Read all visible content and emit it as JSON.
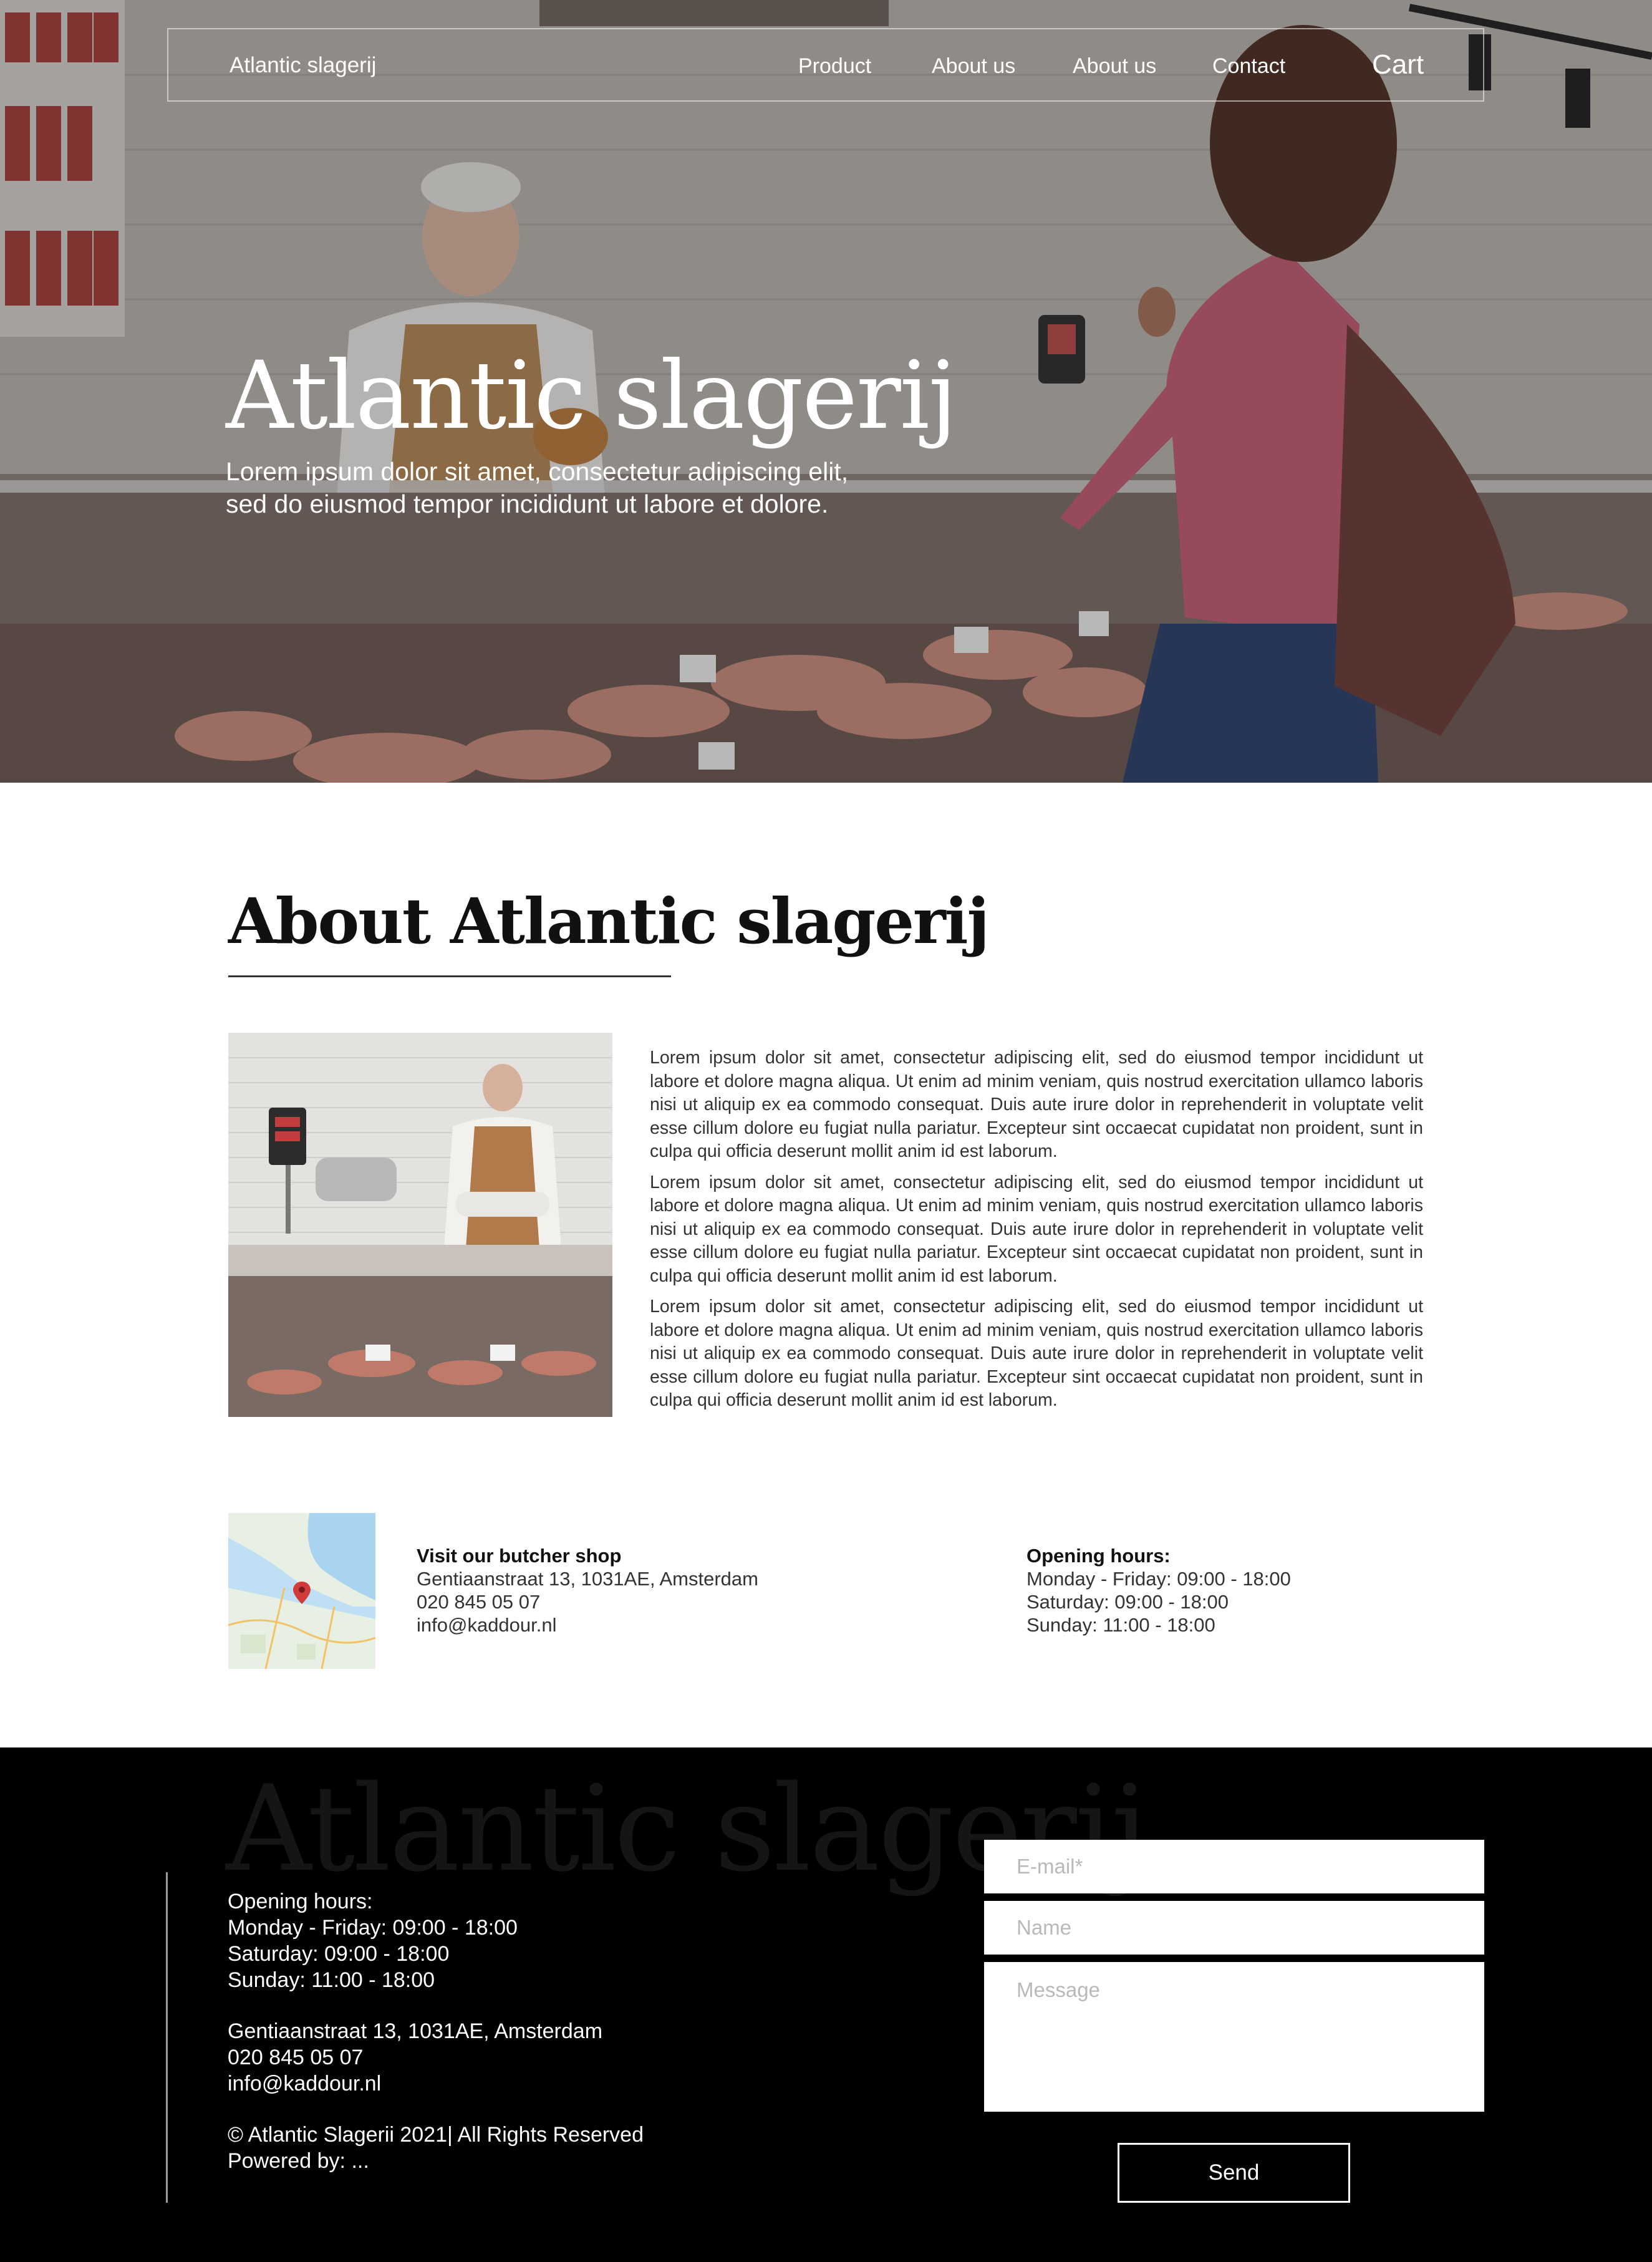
{
  "nav": {
    "brand": "Atlantic slagerij",
    "items": [
      "Product",
      "About us",
      "About us",
      "Contact"
    ],
    "cart": "Cart"
  },
  "hero": {
    "title": "Atlantic slagerij",
    "subtitle_line1": "Lorem ipsum dolor sit amet, consectetur adipiscing elit,",
    "subtitle_line2": "sed do eiusmod tempor incididunt ut labore et dolore."
  },
  "about": {
    "title": "About Atlantic slagerij",
    "paragraphs": [
      "Lorem ipsum dolor sit amet, consectetur adipiscing elit, sed do eiusmod tempor incididunt ut labore et dolore magna aliqua. Ut enim ad minim veniam, quis nostrud exercitation ullamco laboris nisi ut aliquip ex ea commodo consequat. Duis aute irure dolor in reprehenderit in voluptate velit esse cillum dolore eu fugiat nulla pariatur. Excepteur sint occaecat cupidatat non proident, sunt in culpa qui officia deserunt mollit anim id est laborum.",
      "Lorem ipsum dolor sit amet, consectetur adipiscing elit, sed do eiusmod tempor incididunt ut labore et dolore magna aliqua. Ut enim ad minim veniam, quis nostrud exercitation ullamco laboris nisi ut aliquip ex ea commodo consequat. Duis aute irure dolor in reprehenderit in voluptate velit esse cillum dolore eu fugiat nulla pariatur. Excepteur sint occaecat cupidatat non proident, sunt in culpa qui officia deserunt mollit anim id est laborum.",
      "Lorem ipsum dolor sit amet, consectetur adipiscing elit, sed do eiusmod tempor incididunt ut labore et dolore magna aliqua. Ut enim ad minim veniam, quis nostrud exercitation ullamco laboris nisi ut aliquip ex ea commodo consequat. Duis aute irure dolor in reprehenderit in voluptate velit esse cillum dolore eu fugiat nulla pariatur. Excepteur sint occaecat cupidatat non proident, sunt in culpa qui officia deserunt mollit anim id est laborum."
    ]
  },
  "visit": {
    "heading": "Visit our butcher shop",
    "address": "Gentiaanstraat 13, 1031AE, Amsterdam",
    "phone": "020 845 05 07",
    "email": "info@kaddour.nl"
  },
  "hours": {
    "heading": "Opening hours:",
    "weekdays": "Monday - Friday: 09:00 - 18:00",
    "saturday": "Saturday: 09:00 - 18:00",
    "sunday": "Sunday: 11:00 - 18:00"
  },
  "footer": {
    "brand": "Atlantic slagerij",
    "hours_heading": "Opening hours:",
    "weekdays": "Monday - Friday: 09:00 - 18:00",
    "saturday": "Saturday: 09:00 - 18:00",
    "sunday": "Sunday: 11:00 - 18:00",
    "address": "Gentiaanstraat 13, 1031AE, Amsterdam",
    "phone": "020 845 05 07",
    "email": "info@kaddour.nl",
    "copyright": "© Atlantic Slagerii 2021| All Rights Reserved",
    "powered": "Powered by: ..."
  },
  "form": {
    "email_placeholder": "E-mail*",
    "name_placeholder": "Name",
    "message_placeholder": "Message",
    "send_label": "Send"
  },
  "icons": {
    "map_pin": "map-pin-icon"
  },
  "colors": {
    "footer_bg": "#000000",
    "accent_pin": "#d23b3b"
  }
}
